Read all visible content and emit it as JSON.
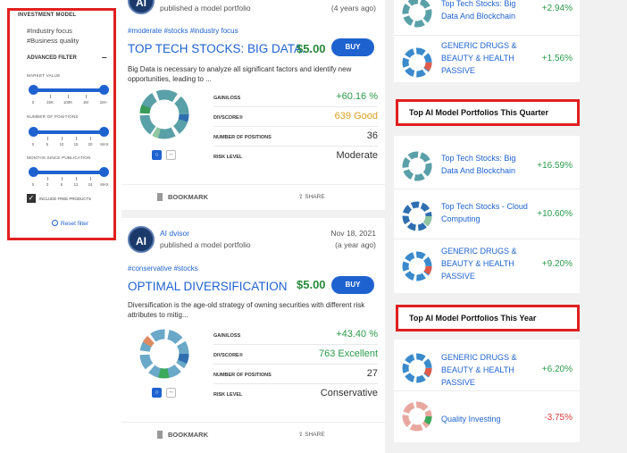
{
  "sidebar": {
    "investment_model": "INVESTMENT MODEL",
    "tags": [
      "#Industry focus",
      "#Business quality"
    ],
    "advanced_filter": "ADVANCED FILTER",
    "collapse": "–",
    "market_value": {
      "label": "MARKET VALUE",
      "ticks": [
        "0",
        "25K",
        "100K",
        "1M",
        "1M+"
      ],
      "range": [
        "0",
        "1M+"
      ]
    },
    "positions": {
      "label": "NUMBER OF POSITIONS",
      "ticks": [
        "0",
        "5",
        "10",
        "15",
        "20",
        "MAX"
      ],
      "range": [
        "0",
        "MAX"
      ]
    },
    "months": {
      "label": "MONTHS SINCE PUBLICATION",
      "ticks": [
        "0",
        "3",
        "6",
        "12",
        "24",
        "MAX"
      ],
      "range": [
        "0",
        "MAX"
      ]
    },
    "include_free": "INCLUDE FREE PRODUCTS",
    "include_free_checked": true,
    "reset": "Reset filter"
  },
  "cards": [
    {
      "avatar": "AI",
      "action": "published a model portfolio",
      "ago": "(4 years ago)",
      "tags": "#moderate #stocks #industry focus",
      "title": "TOP TECH STOCKS: BIG DATA...",
      "price": "$5.00",
      "buy": "BUY",
      "description": "Big Data is necessary to analyze all significant factors and identify new opportunities, leading to ...",
      "stats": [
        {
          "k": "GAIN/LOSS",
          "v": "+60.16 %",
          "color": "#2a9a4a"
        },
        {
          "k": "DIVSCORE®",
          "v": "639 Good",
          "color": "#d9a020"
        },
        {
          "k": "NUMBER OF POSITIONS",
          "v": "36",
          "color": "#333333"
        },
        {
          "k": "RISK LEVEL",
          "v": "Moderate",
          "color": "#333333"
        }
      ],
      "bookmark": "BOOKMARK",
      "share": "SHARE"
    },
    {
      "avatar": "AI",
      "author": "AI dvisor",
      "action": "published a model portfolio",
      "date": "Nov 18, 2021",
      "ago": "(a year ago)",
      "tags": "#conservative #stocks",
      "title": "OPTIMAL DIVERSIFICATION",
      "price": "$5.00",
      "buy": "BUY",
      "description": "Diversification is the age-old strategy of owning securities with different risk attributes to mitig...",
      "stats": [
        {
          "k": "GAIN/LOSS",
          "v": "+43.40 %",
          "color": "#2a9a4a"
        },
        {
          "k": "DIVSCORE®",
          "v": "763 Excellent",
          "color": "#2a9a4a"
        },
        {
          "k": "NUMBER OF POSITIONS",
          "v": "27",
          "color": "#333333"
        },
        {
          "k": "RISK LEVEL",
          "v": "Conservative",
          "color": "#333333"
        }
      ],
      "bookmark": "BOOKMARK",
      "share": "SHARE"
    }
  ],
  "right_top": [
    {
      "name": "Top Tech Stocks: Big Data And Blockchain",
      "value": "+2.94%",
      "positive": true
    },
    {
      "name": "GENERIC DRUGS & BEAUTY & HEALTH PASSIVE",
      "value": "+1.56%",
      "positive": true
    }
  ],
  "quarter": {
    "title": "Top AI Model Portfolios This Quarter",
    "items": [
      {
        "name": "Top Tech Stocks: Big Data And Blockchain",
        "value": "+16.59%",
        "positive": true
      },
      {
        "name": "Top Tech Stocks - Cloud Computing",
        "value": "+10.60%",
        "positive": true
      },
      {
        "name": "GENERIC DRUGS & BEAUTY & HEALTH PASSIVE",
        "value": "+9.20%",
        "positive": true
      }
    ]
  },
  "year": {
    "title": "Top AI Model Portfolios This Year",
    "items": [
      {
        "name": "GENERIC DRUGS & BEAUTY & HEALTH PASSIVE",
        "value": "+6.20%",
        "positive": true
      },
      {
        "name": "Quality Investing",
        "value": "-3.75%",
        "positive": false
      }
    ]
  },
  "colors": {
    "accent": "#1e62d0",
    "positive": "#2a9a4a",
    "negative": "#d93a3a",
    "highlight": "#e02020"
  }
}
